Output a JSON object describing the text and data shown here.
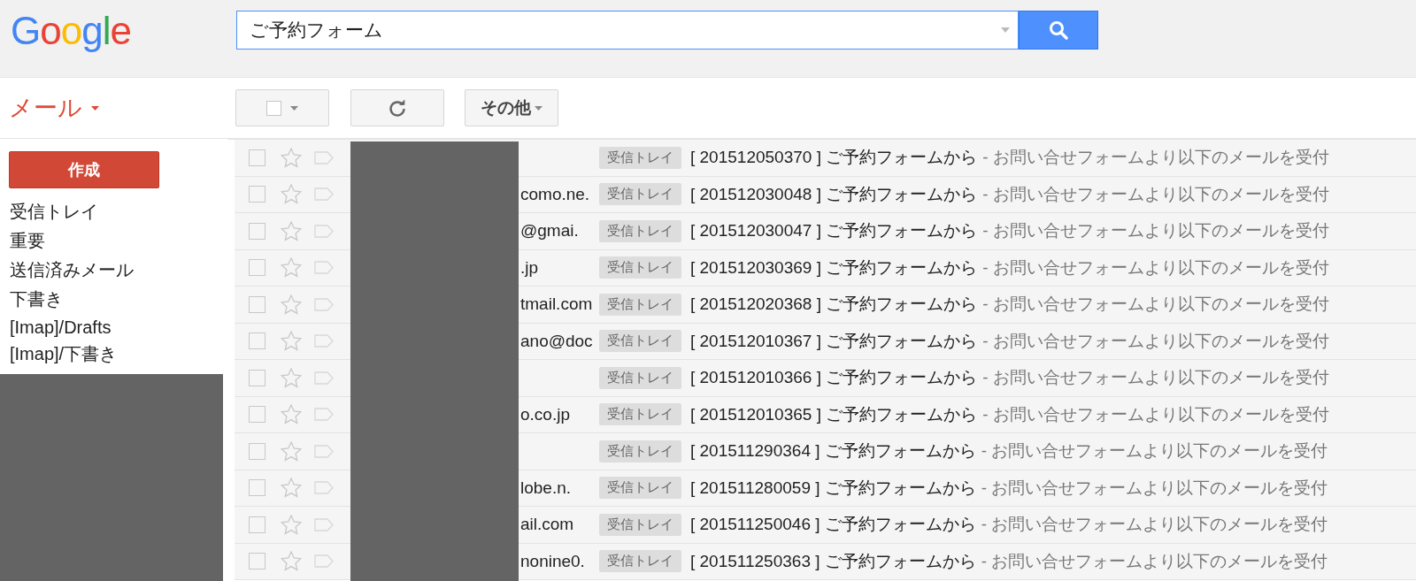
{
  "header": {
    "logo": "Google",
    "search": {
      "value": "ご予約フォーム"
    }
  },
  "app_menu": {
    "label": "メール"
  },
  "toolbar": {
    "select_checked": false,
    "more_label": "その他"
  },
  "sidebar": {
    "compose": "作成",
    "items": [
      {
        "label": "受信トレイ"
      },
      {
        "label": "重要"
      },
      {
        "label": "送信済みメール"
      },
      {
        "label": "下書き"
      },
      {
        "label": "[Imap]/Drafts"
      },
      {
        "label": "[Imap]/下書き"
      }
    ]
  },
  "messages": [
    {
      "checked": false,
      "starred": false,
      "tag": "受信トレイ",
      "subject": "[ 201512050370 ] ご予約フォームから",
      "snippet": "- お問い合せフォームより以下のメールを受付"
    },
    {
      "checked": false,
      "starred": false,
      "sender": "como.ne.",
      "tag": "受信トレイ",
      "subject": "[ 201512030048 ] ご予約フォームから",
      "snippet": "- お問い合せフォームより以下のメールを受付"
    },
    {
      "checked": false,
      "starred": false,
      "sender": "@gmai.",
      "tag": "受信トレイ",
      "subject": "[ 201512030047 ] ご予約フォームから",
      "snippet": "- お問い合せフォームより以下のメールを受付"
    },
    {
      "checked": false,
      "starred": false,
      "sender": ".jp",
      "tag": "受信トレイ",
      "subject": "[ 201512030369 ] ご予約フォームから",
      "snippet": "- お問い合せフォームより以下のメールを受付"
    },
    {
      "checked": false,
      "starred": false,
      "sender": "tmail.com",
      "tag": "受信トレイ",
      "subject": "[ 201512020368 ] ご予約フォームから",
      "snippet": "- お問い合せフォームより以下のメールを受付"
    },
    {
      "checked": false,
      "starred": false,
      "sender": "ano@doc",
      "tag": "受信トレイ",
      "subject": "[ 201512010367 ] ご予約フォームから",
      "snippet": "- お問い合せフォームより以下のメールを受付"
    },
    {
      "checked": false,
      "starred": false,
      "tag": "受信トレイ",
      "subject": "[ 201512010366 ] ご予約フォームから",
      "snippet": "- お問い合せフォームより以下のメールを受付"
    },
    {
      "checked": false,
      "starred": false,
      "sender": "o.co.jp",
      "tag": "受信トレイ",
      "subject": "[ 201512010365 ] ご予約フォームから",
      "snippet": "- お問い合せフォームより以下のメールを受付"
    },
    {
      "checked": false,
      "starred": false,
      "tag": "受信トレイ",
      "subject": "[ 201511290364 ] ご予約フォームから",
      "snippet": "- お問い合せフォームより以下のメールを受付"
    },
    {
      "checked": false,
      "starred": false,
      "sender": "lobe.n.",
      "tag": "受信トレイ",
      "subject": "[ 201511280059 ] ご予約フォームから",
      "snippet": "- お問い合せフォームより以下のメールを受付"
    },
    {
      "checked": false,
      "starred": false,
      "sender": "ail.com",
      "tag": "受信トレイ",
      "subject": "[ 201511250046 ] ご予約フォームから",
      "snippet": "- お問い合せフォームより以下のメールを受付"
    },
    {
      "checked": false,
      "starred": false,
      "sender": "nonine0.",
      "tag": "受信トレイ",
      "subject": "[ 201511250363 ] ご予約フォームから",
      "snippet": "- お問い合せフォームより以下のメールを受付"
    }
  ]
}
